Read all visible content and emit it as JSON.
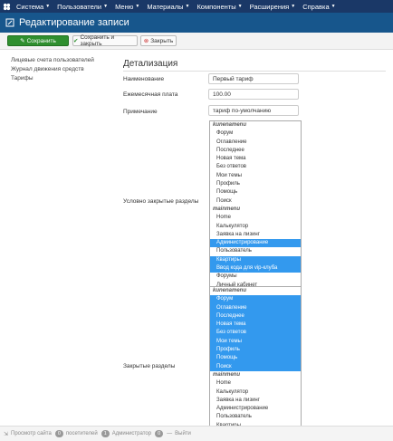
{
  "navbar": {
    "items": [
      {
        "label": "Система"
      },
      {
        "label": "Пользователи"
      },
      {
        "label": "Меню"
      },
      {
        "label": "Материалы"
      },
      {
        "label": "Компоненты"
      },
      {
        "label": "Расширения"
      },
      {
        "label": "Справка"
      }
    ]
  },
  "title": "Редактирование записи",
  "toolbar": {
    "save_label": "Сохранить",
    "save_close_label": "Сохранить и закрыть",
    "close_label": "Закрыть"
  },
  "sidebar": {
    "items": [
      {
        "label": "Лицевые счета пользователей"
      },
      {
        "label": "Журнал движения средств"
      },
      {
        "label": "Тарифы"
      }
    ]
  },
  "form": {
    "section_title": "Детализация",
    "name_label": "Наименование",
    "name_value": "Первый тариф",
    "fee_label": "Ежемесячная плата",
    "fee_value": "100.00",
    "note_label": "Примечание",
    "note_value": "тариф по-умолчанию",
    "cond_label": "Условно закрытые разделы",
    "closed_label": "Закрытые разделы"
  },
  "cond_list": [
    {
      "label": "kunenamenu",
      "group": true
    },
    {
      "label": "Форум"
    },
    {
      "label": "Оглавление"
    },
    {
      "label": "Последнее"
    },
    {
      "label": "Новая тема"
    },
    {
      "label": "Без ответов"
    },
    {
      "label": "Мои темы"
    },
    {
      "label": "Профиль"
    },
    {
      "label": "Помощь"
    },
    {
      "label": "Поиск"
    },
    {
      "label": "mainmenu",
      "group": true
    },
    {
      "label": "Home"
    },
    {
      "label": "Калькулятор"
    },
    {
      "label": "Заявка на лизинг"
    },
    {
      "label": "Администрирование",
      "selected": true
    },
    {
      "label": "Пользователь"
    },
    {
      "label": "Квартиры",
      "selected": true
    },
    {
      "label": "Ввод кода для vip-клуба",
      "selected": true
    },
    {
      "label": "Форумы"
    },
    {
      "label": "Личный кабинет"
    }
  ],
  "closed_list": [
    {
      "label": "kunenamenu",
      "group": true
    },
    {
      "label": "Форум",
      "selected": true
    },
    {
      "label": "Оглавление",
      "selected": true
    },
    {
      "label": "Последнее",
      "selected": true
    },
    {
      "label": "Новая тема",
      "selected": true
    },
    {
      "label": "Без ответов",
      "selected": true
    },
    {
      "label": "Мои темы",
      "selected": true
    },
    {
      "label": "Профиль",
      "selected": true
    },
    {
      "label": "Помощь",
      "selected": true
    },
    {
      "label": "Поиск",
      "selected": true
    },
    {
      "label": "mainmenu",
      "group": true
    },
    {
      "label": "Home"
    },
    {
      "label": "Калькулятор"
    },
    {
      "label": "Заявка на лизинг"
    },
    {
      "label": "Администрирование"
    },
    {
      "label": "Пользователь"
    },
    {
      "label": "Квартиры"
    }
  ],
  "statusbar": {
    "view_site": "Просмотр сайта",
    "visitors_count": "0",
    "visitors_label": "посетителей",
    "admins_count": "1",
    "admins_label": "Администратор",
    "messages_count": "0",
    "logout": "Выйти"
  },
  "colors": {
    "navbar": "#1a3867",
    "titlebar": "#17568c",
    "save_button": "#2f8f2f",
    "selected_option": "#3399ee"
  }
}
